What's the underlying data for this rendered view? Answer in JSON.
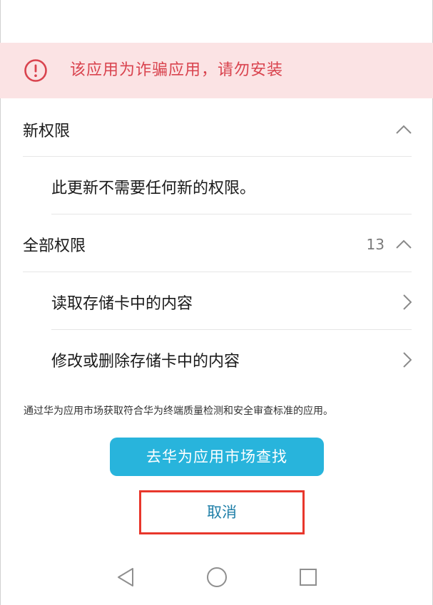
{
  "warning": {
    "text": "该应用为诈骗应用，请勿安装",
    "color": "#d9434e",
    "background": "#fbe3e4",
    "icon": "exclamation-circle-icon"
  },
  "new_permissions": {
    "title": "新权限",
    "expanded": true,
    "items": [
      {
        "label": "此更新不需要任何新的权限。"
      }
    ]
  },
  "all_permissions": {
    "title": "全部权限",
    "count": "13",
    "expanded": true,
    "items": [
      {
        "label": "读取存储卡中的内容"
      },
      {
        "label": "修改或删除存储卡中的内容"
      }
    ]
  },
  "footer_note": "通过华为应用市场获取符合华为终端质量检测和安全审查标准的应用。",
  "buttons": {
    "market": "去华为应用市场查找",
    "cancel": "取消",
    "accent": "#28b4dc",
    "highlight": "#e8372c"
  },
  "navbar": {
    "back": "triangle-back-icon",
    "home": "circle-home-icon",
    "recents": "square-recents-icon"
  }
}
